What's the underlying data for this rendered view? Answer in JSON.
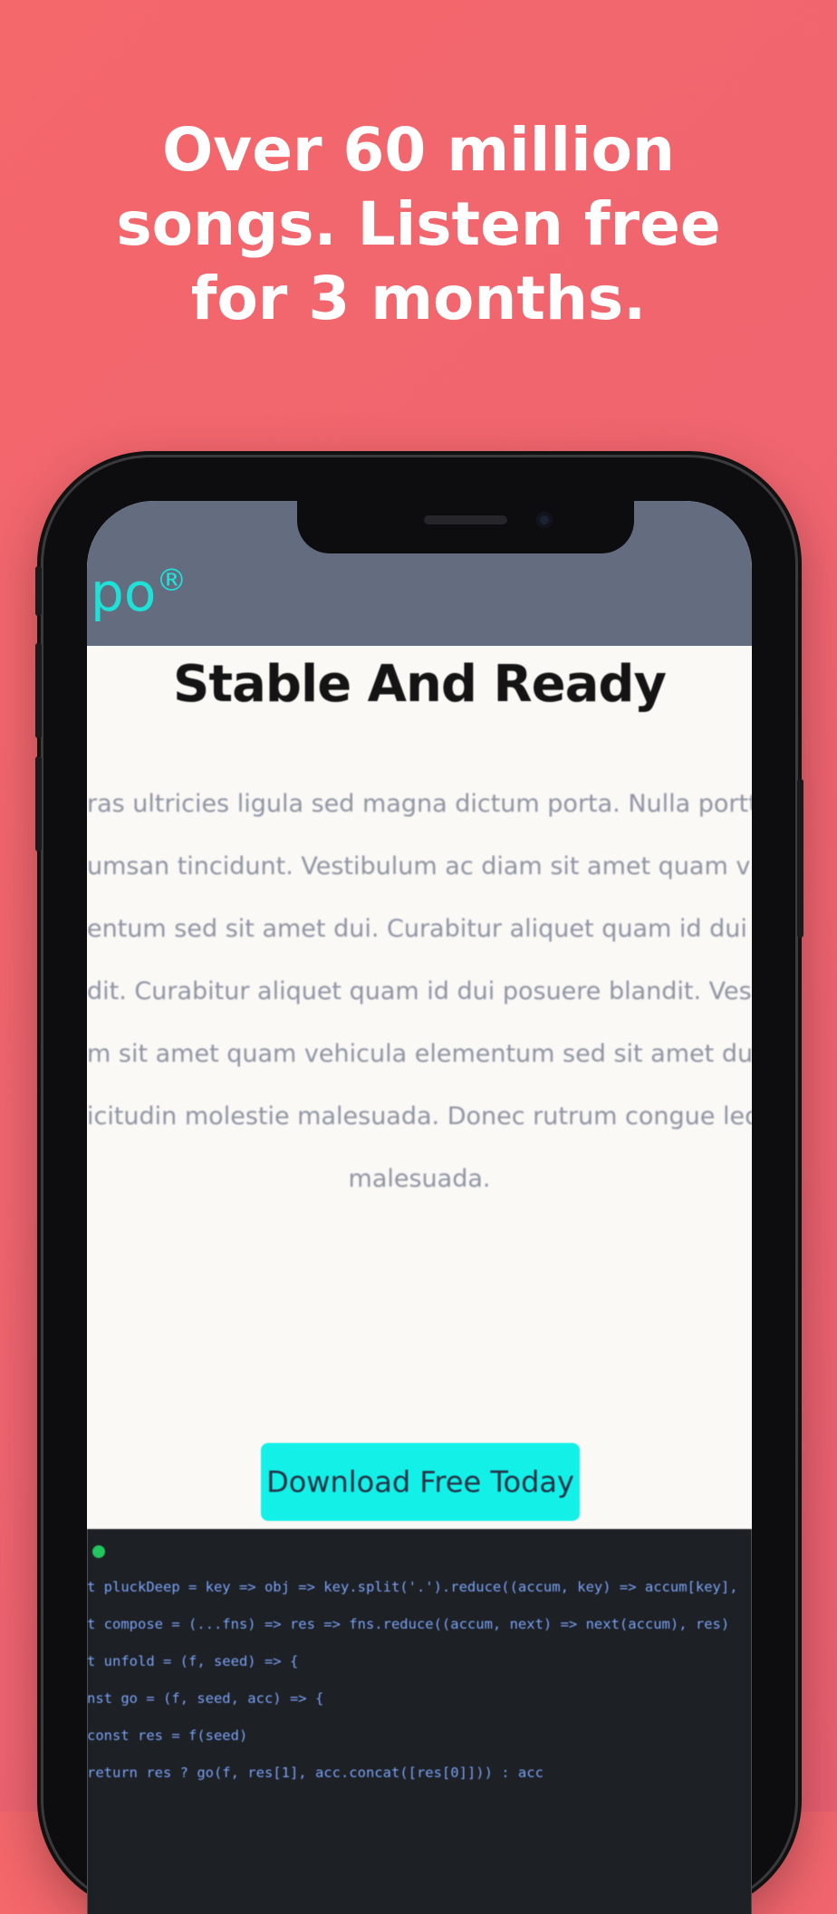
{
  "headline": {
    "lines": [
      "Over 60 million",
      "songs. Listen free",
      "for 3 months."
    ]
  },
  "app": {
    "logo_text": "po",
    "logo_mark": "®",
    "title": "Stable And Ready",
    "paragraph_lines": [
      "ras ultricies ligula sed magna dictum porta. Nulla porttito",
      "umsan tincidunt. Vestibulum ac diam sit amet quam vehic",
      "entum sed sit amet dui. Curabitur aliquet quam id dui pos",
      "dit. Curabitur aliquet quam id dui posuere blandit. Vestibu",
      "m sit amet quam vehicula elementum sed sit amet dui. D",
      "icitudin molestie malesuada. Donec rutrum congue leo e",
      "malesuada."
    ],
    "cta_label": "Download Free Today"
  },
  "code": {
    "lines": [
      "t pluckDeep = key => obj => key.split('.').reduce((accum, key) => accum[key],",
      "t compose = (...fns) => res => fns.reduce((accum, next) => next(accum), res)",
      "t unfold = (f, seed) => {",
      "nst go = (f, seed, acc) => {",
      "const res = f(seed)",
      "return res ? go(f, res[1], acc.concat([res[0]])) : acc"
    ]
  },
  "colors": {
    "background": "#f0656f",
    "accent": "#12f0e8",
    "header": "#646d7f",
    "code_background": "#1d2024",
    "status_dot": "#22c55e"
  }
}
